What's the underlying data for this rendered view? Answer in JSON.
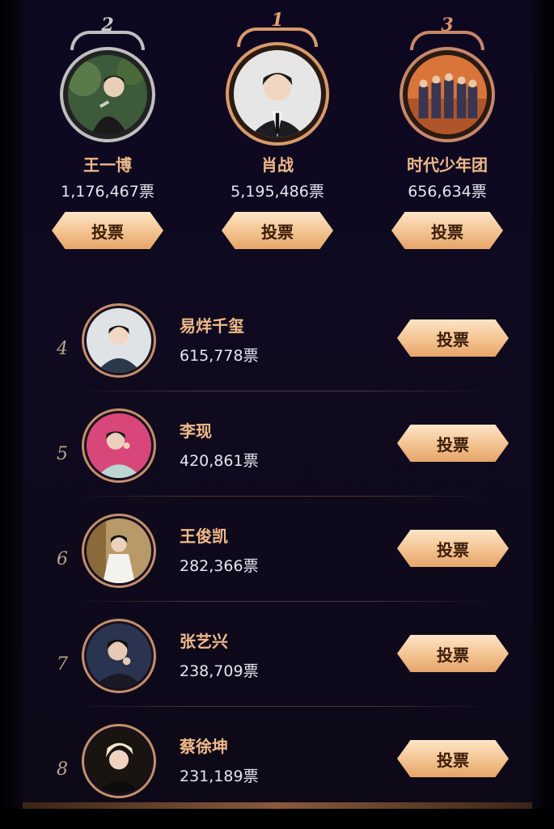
{
  "button_label": "投票",
  "vote_suffix": "票",
  "podium": [
    {
      "rank": "2",
      "name": "王一博",
      "votes": "1,176,467票",
      "rank_color": "#c9c9c9",
      "frame_color": "#bfbfbf"
    },
    {
      "rank": "1",
      "name": "肖战",
      "votes": "5,195,486票",
      "rank_color": "#e8a36e",
      "frame_color": "#d99a6a"
    },
    {
      "rank": "3",
      "name": "时代少年团",
      "votes": "656,634票",
      "rank_color": "#d9906a",
      "frame_color": "#c8876a"
    }
  ],
  "list": [
    {
      "rank": "4",
      "name": "易烊千玺",
      "votes": "615,778票"
    },
    {
      "rank": "5",
      "name": "李现",
      "votes": "420,861票"
    },
    {
      "rank": "6",
      "name": "王俊凯",
      "votes": "282,366票"
    },
    {
      "rank": "7",
      "name": "张艺兴",
      "votes": "238,709票"
    },
    {
      "rank": "8",
      "name": "蔡徐坤",
      "votes": "231,189票"
    }
  ],
  "colors": {
    "accent": "#f0b98a",
    "button_top": "#fde5c7",
    "button_bottom": "#e6a46a",
    "background": "#0e0918"
  }
}
